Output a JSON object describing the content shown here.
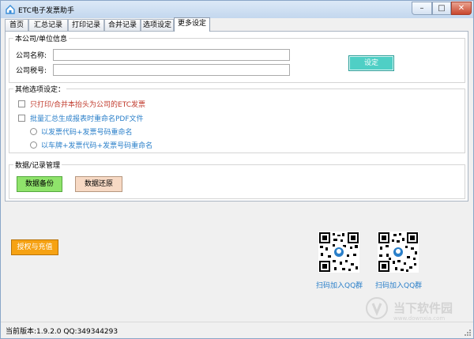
{
  "window": {
    "title": "ETC电子发票助手"
  },
  "window_buttons": {
    "minimize": "–",
    "maximize": "□",
    "close": "✕"
  },
  "tabs": [
    {
      "label": "首页"
    },
    {
      "label": "汇总记录"
    },
    {
      "label": "打印记录"
    },
    {
      "label": "合并记录"
    },
    {
      "label": "选项设定"
    },
    {
      "label": "更多设定"
    }
  ],
  "company_group": {
    "title": "本公司/单位信息",
    "name_label": "公司名称:",
    "name_value": "",
    "tax_label": "公司税号:",
    "tax_value": "",
    "set_button": "设定"
  },
  "options_group": {
    "title": "其他选项设定：",
    "option1": "只打印/合并本抬头为公司的ETC发票",
    "option2": "批量汇总生成报表时重命名PDF文件",
    "radio1": "以发票代码+发票号码重命名",
    "radio2": "以车牌+发票代码+发票号码重命名"
  },
  "data_group": {
    "title": "数据/记录管理",
    "backup": "数据备份",
    "restore": "数据还原"
  },
  "auth_button": "授权与充值",
  "qr": [
    {
      "caption": "扫码加入QQ群"
    },
    {
      "caption": "扫码加入QQ群"
    }
  ],
  "status": {
    "text": "当前版本:1.9.2.0   QQ:349344293"
  },
  "watermark": {
    "text": "当下软件园",
    "sub": "www.downxia.com"
  },
  "colors": {
    "set_button": "#4fcfc5",
    "backup_button": "#8fe36b",
    "restore_button": "#f7d9c4",
    "auth_button": "#f6a213",
    "link_blue": "#2a7fc9",
    "option_red": "#c0392b"
  }
}
